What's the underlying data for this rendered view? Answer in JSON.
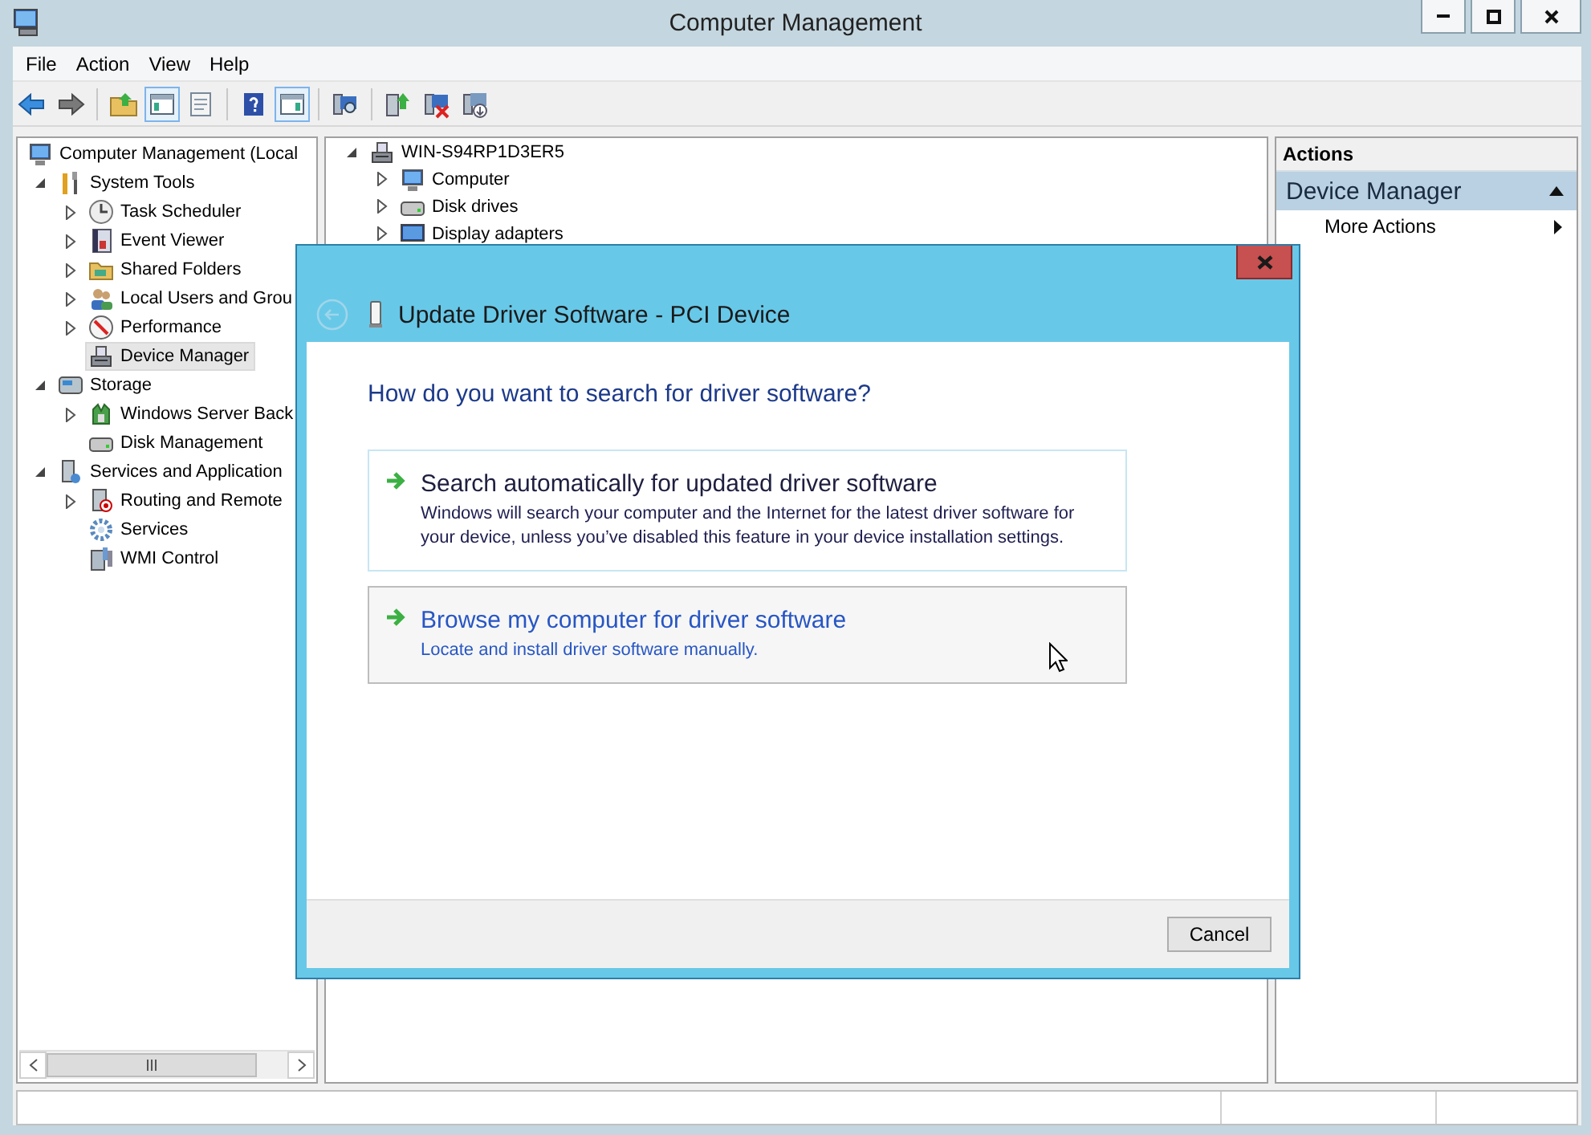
{
  "window": {
    "title": "Computer Management"
  },
  "menu": [
    "File",
    "Action",
    "View",
    "Help"
  ],
  "toolbar": [
    {
      "kind": "button",
      "pressed": false
    },
    {
      "kind": "button",
      "pressed": false
    },
    {
      "kind": "separator"
    },
    {
      "kind": "button",
      "pressed": false
    },
    {
      "kind": "button",
      "pressed": true
    },
    {
      "kind": "button",
      "pressed": false
    },
    {
      "kind": "separator"
    },
    {
      "kind": "button",
      "pressed": false
    },
    {
      "kind": "button",
      "pressed": true
    },
    {
      "kind": "separator"
    },
    {
      "kind": "button",
      "pressed": false
    },
    {
      "kind": "separator"
    },
    {
      "kind": "button",
      "pressed": false
    },
    {
      "kind": "button",
      "pressed": false
    },
    {
      "kind": "button",
      "pressed": false
    }
  ],
  "console_tree": {
    "items": [
      {
        "label": "Computer Management (Local",
        "kind": "leaf",
        "selected": false,
        "children": [
          {
            "label": "System Tools",
            "kind": "node",
            "expanded": true,
            "selected": false,
            "children": [
              {
                "label": "Task Scheduler",
                "kind": "node",
                "expanded": false,
                "selected": false
              },
              {
                "label": "Event Viewer",
                "kind": "node",
                "expanded": false,
                "selected": false
              },
              {
                "label": "Shared Folders",
                "kind": "node",
                "expanded": false,
                "selected": false
              },
              {
                "label": "Local Users and Grou",
                "kind": "node",
                "expanded": false,
                "selected": false
              },
              {
                "label": "Performance",
                "kind": "node",
                "expanded": false,
                "selected": false
              },
              {
                "label": "Device Manager",
                "kind": "leaf",
                "selected": true
              }
            ]
          },
          {
            "label": "Storage",
            "kind": "node",
            "expanded": true,
            "selected": false,
            "children": [
              {
                "label": "Windows Server Back",
                "kind": "node",
                "expanded": false,
                "selected": false
              },
              {
                "label": "Disk Management",
                "kind": "leaf",
                "selected": false
              }
            ]
          },
          {
            "label": "Services and Application",
            "kind": "node",
            "expanded": true,
            "selected": false,
            "children": [
              {
                "label": "Routing and Remote",
                "kind": "node",
                "expanded": false,
                "selected": false
              },
              {
                "label": "Services",
                "kind": "leaf",
                "selected": false
              },
              {
                "label": "WMI Control",
                "kind": "leaf",
                "selected": false
              }
            ]
          }
        ]
      }
    ]
  },
  "device_tree": {
    "items": [
      {
        "label": "WIN-S94RP1D3ER5",
        "kind": "node",
        "expanded": true,
        "selected": false,
        "children": [
          {
            "label": "Computer",
            "kind": "node",
            "expanded": false,
            "selected": false
          },
          {
            "label": "Disk drives",
            "kind": "node",
            "expanded": false,
            "selected": false
          },
          {
            "label": "Display adapters",
            "kind": "node",
            "expanded": false,
            "selected": false
          }
        ]
      }
    ]
  },
  "actions": {
    "header": "Actions",
    "sections": [
      {
        "title": "Device Manager",
        "expanded": true,
        "items": [
          {
            "label": "More Actions"
          }
        ]
      }
    ]
  },
  "dialog": {
    "title": "Update Driver Software - PCI Device",
    "back_disabled": true,
    "heading": "How do you want to search for driver software?",
    "options": [
      {
        "title": "Search automatically for updated driver software",
        "description": "Windows will search your computer and the Internet for the latest driver software for your device, unless you’ve disabled this feature in your device installation settings.",
        "focused": true,
        "hovered": false
      },
      {
        "title": "Browse my computer for driver software",
        "description": "Locate and install driver software manually.",
        "focused": false,
        "hovered": true
      }
    ],
    "buttons": [
      "Cancel"
    ]
  }
}
